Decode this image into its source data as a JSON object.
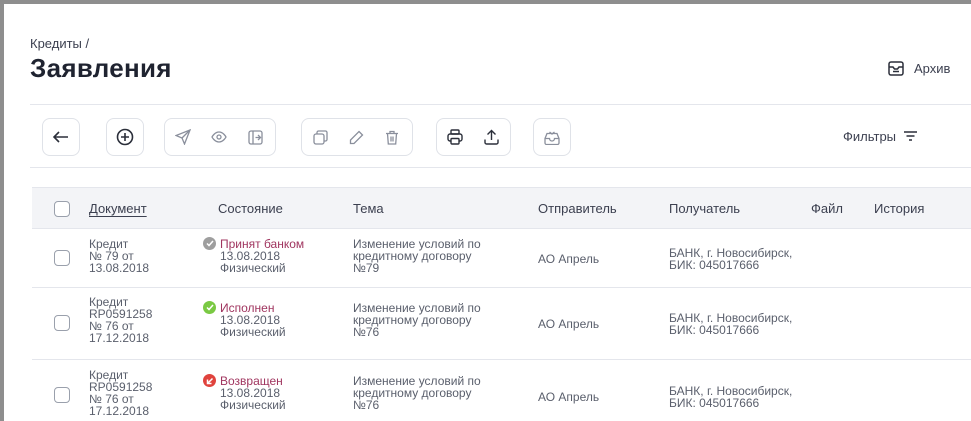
{
  "breadcrumb": "Кредиты /",
  "title": "Заявления",
  "archive": {
    "label": "Архив",
    "icon": "archive-icon"
  },
  "toolbar": {
    "icons": [
      "back-arrow-icon",
      "add-circle-icon",
      "send-icon",
      "eye-icon",
      "sign-in-icon",
      "copy-icon",
      "edit-icon",
      "delete-icon",
      "print-icon",
      "upload-icon",
      "inbox-icon"
    ]
  },
  "filters": {
    "label": "Фильтры",
    "icon": "filter-icon"
  },
  "table": {
    "headers": {
      "document": "Документ",
      "state": "Состояние",
      "topic": "Тема",
      "sender": "Отправитель",
      "recipient": "Получатель",
      "file": "Файл",
      "history": "История"
    },
    "rows": [
      {
        "document": [
          "Кредит",
          "№ 79 от",
          "13.08.2018"
        ],
        "status": {
          "label": "Принят банком",
          "icon": "check-icon",
          "color": "#9e9e9e"
        },
        "state_lines": [
          "13.08.2018",
          "Физический"
        ],
        "topic": [
          "Изменение условий по",
          "кредитному договору",
          "№79"
        ],
        "sender": "АО Апрель",
        "recipient": [
          "БАНК, г. Новосибирск,",
          "БИК: 045017666"
        ]
      },
      {
        "document": [
          "Кредит",
          "RP0591258",
          "№ 76 от",
          "17.12.2018"
        ],
        "status": {
          "label": "Исполнен",
          "icon": "check-icon",
          "color": "#7ac943"
        },
        "state_lines": [
          "13.08.2018",
          "Физический"
        ],
        "topic": [
          "Изменение условий по",
          "кредитному договору",
          "№76"
        ],
        "sender": "АО Апрель",
        "recipient": [
          "БАНК, г. Новосибирск,",
          "БИК: 045017666"
        ]
      },
      {
        "document": [
          "Кредит",
          "RP0591258",
          "№ 76 от",
          "17.12.2018"
        ],
        "status": {
          "label": "Возвращен",
          "icon": "return-icon",
          "color": "#e0433d"
        },
        "state_lines": [
          "13.08.2018",
          "Физический"
        ],
        "topic": [
          "Изменение условий по",
          "кредитному договору",
          "№76"
        ],
        "sender": "АО Апрель",
        "recipient": [
          "БАНК, г. Новосибирск,",
          "БИК: 045017666"
        ]
      }
    ]
  }
}
